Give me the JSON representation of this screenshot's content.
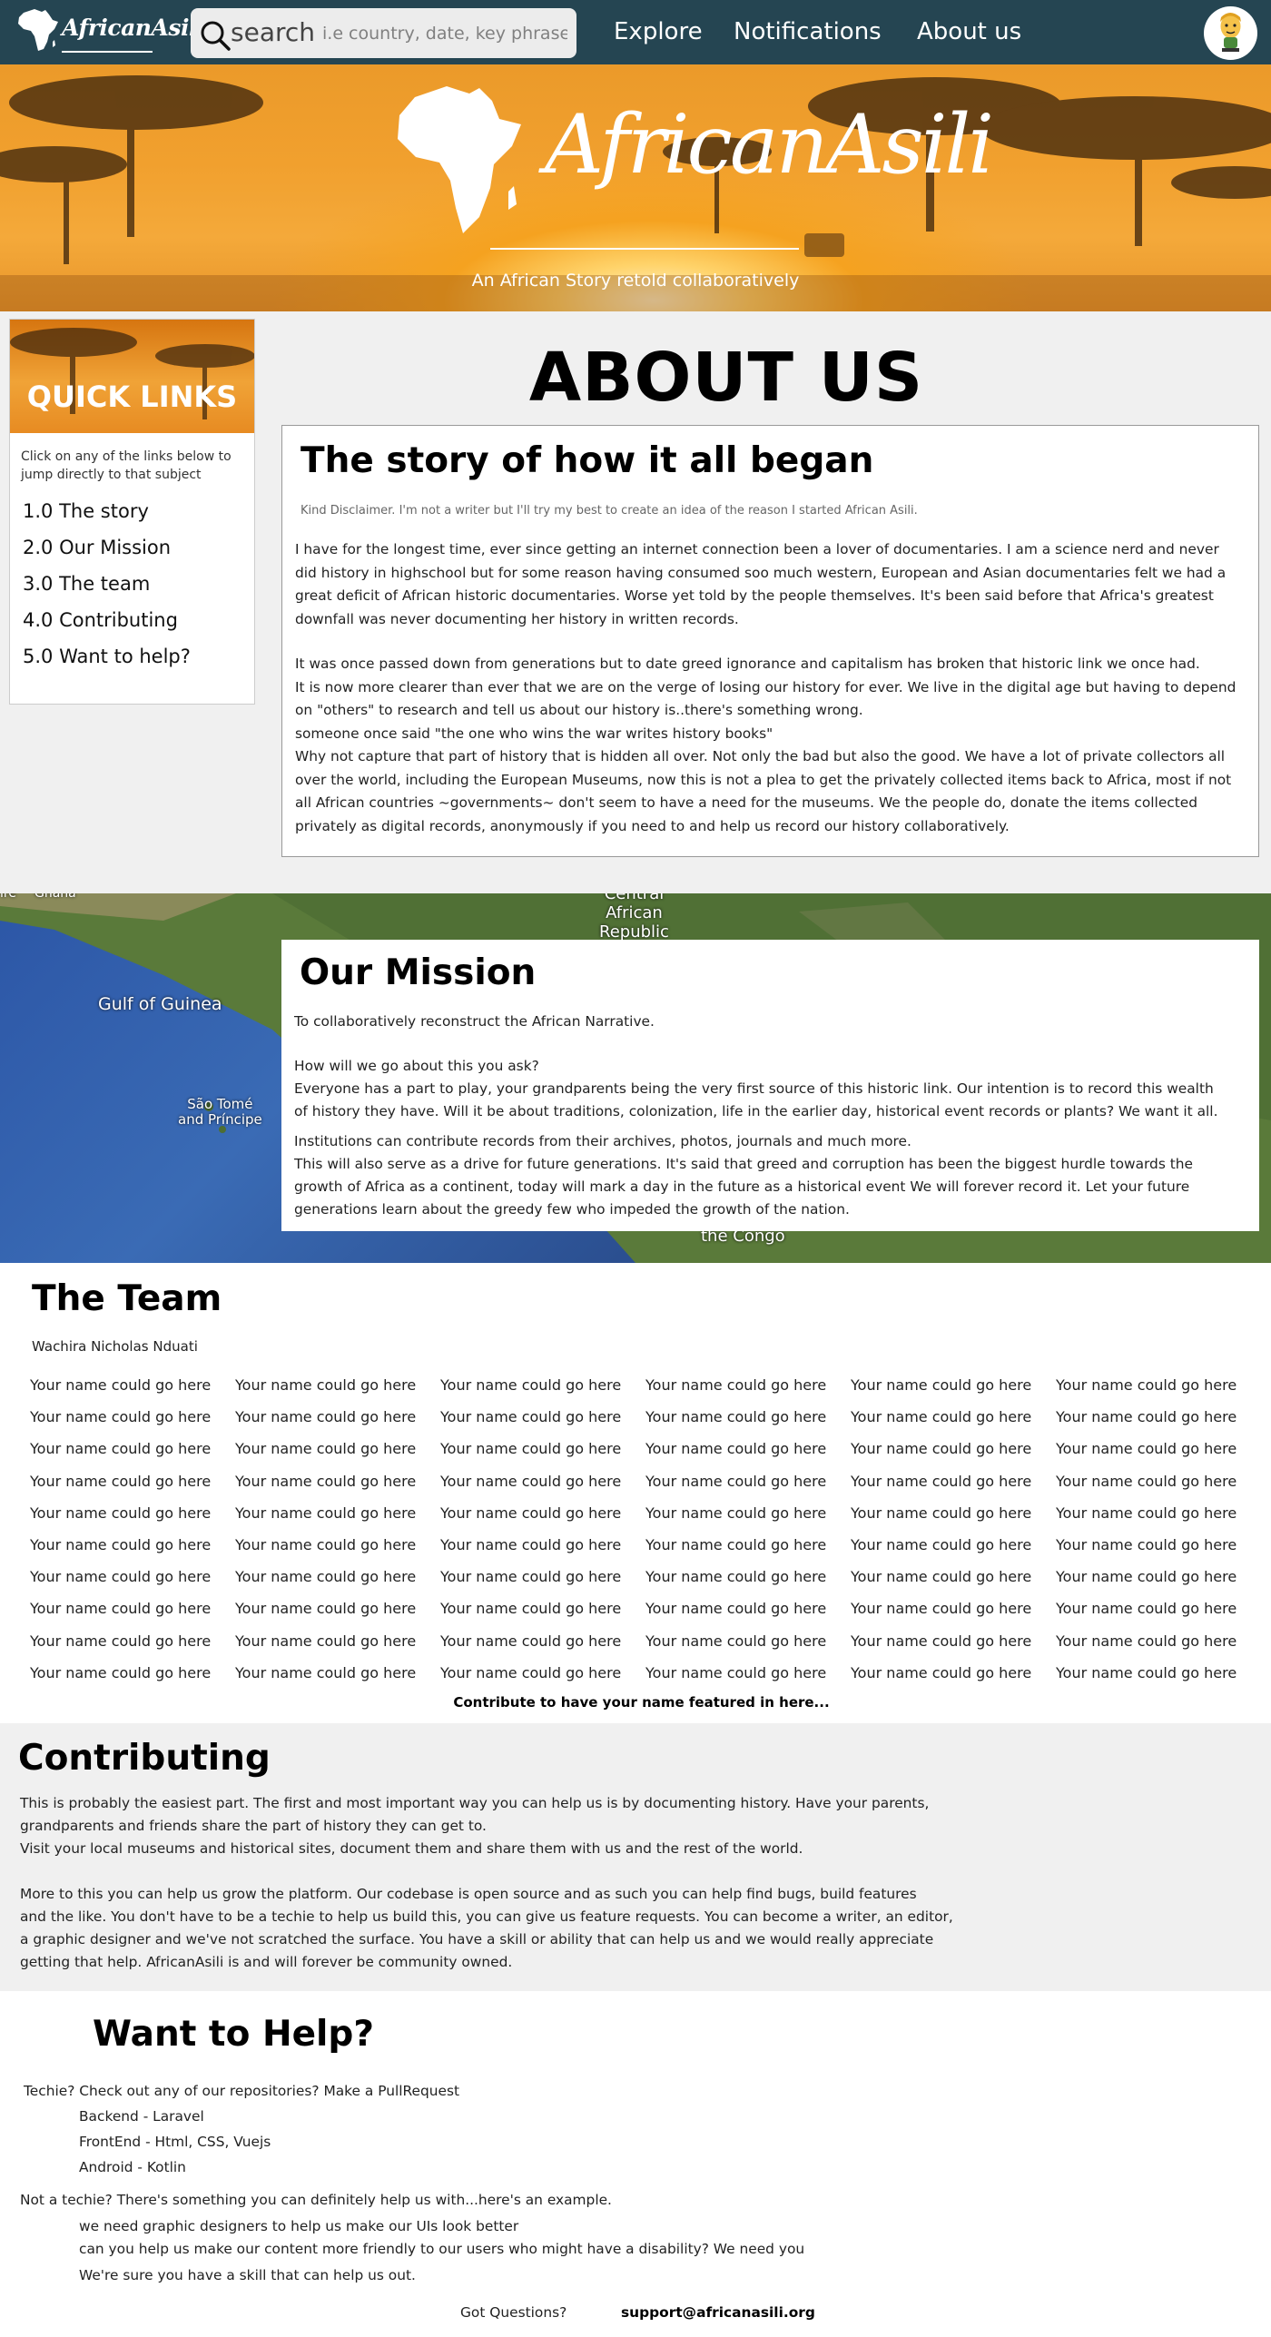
{
  "navbar": {
    "brand": "AfricanAsili",
    "search_label": "search",
    "search_placeholder": "i.e country, date, key phrase",
    "links": [
      "Explore",
      "Notifications",
      "About us"
    ]
  },
  "hero": {
    "title": "AfricanAsili",
    "subtitle": "An African Story retold collaboratively"
  },
  "quick_links": {
    "title": "QUICK LINKS",
    "intro": "Click on any of the links below to jump directly to that subject",
    "items": [
      "1.0 The story",
      "2.0 Our Mission",
      "3.0 The team",
      "4.0 Contributing",
      "5.0 Want to help?"
    ]
  },
  "about": {
    "title": "ABOUT US",
    "story_title": "The story of how it all began",
    "disclaimer": "Kind Disclaimer. I'm not a writer but I'll try my best to create an idea of the reason I started African Asili.",
    "para1": "I have for the longest time, ever since getting an internet connection been a lover of documentaries. I am a science nerd and never\ndid history in highschool but for some reason having consumed soo much western, European and Asian documentaries felt we had a\ngreat deficit of African historic documentaries. Worse yet told by the people themselves. It's been said before that Africa's greatest\ndownfall was never documenting her history in written records.",
    "para2": "It was once passed down from generations but to date greed ignorance and capitalism has broken that historic link we once had.\nIt is now more clearer than ever that we are on the verge of losing our history for ever. We live in the digital age but having to depend\non \"others\" to research and tell us about our history is..there's something wrong.\nsomeone once said \"the one who wins the war writes history books\"\nWhy not capture that part of history that is hidden all over. Not only the bad but also the good. We have a lot of private collectors all\nover the world, including the European Museums, now this is not a plea to get the privately collected items back to Africa, most if not\nall African countries ~governments~ don't seem to have a need for the museums. We the people do, donate the items collected\nprivately as digital records, anonymously if you need to and help us record our history collaboratively."
  },
  "map_labels": {
    "gulf": "Gulf of Guinea",
    "sao_tome": "São Tomé\nand Príncipe",
    "car": "Central\nAfrican\nRepublic",
    "congo": "the Congo",
    "left": "ire",
    "ghana": "Ghana"
  },
  "mission": {
    "title": "Our Mission",
    "para1": "To collaboratively reconstruct the African Narrative.",
    "para2": "How will we go about this you ask?\nEveryone has a part to play, your grandparents being the very first source of this historic link. Our intention is to record this wealth\nof history they have. Will it be about traditions, colonization, life in the earlier day, historical event records or plants? We want it all.",
    "para3": "Institutions can contribute records from their archives, photos, journals and much more.\nThis will also serve as a drive for future generations. It's said that greed and corruption has been the biggest hurdle towards the\ngrowth of Africa as a continent, today will mark a day in the future as a historical event We will forever record it. Let your future\ngenerations learn about the greedy few who impeded the growth of the nation."
  },
  "team": {
    "title": "The Team",
    "lead": "Wachira Nicholas Nduati",
    "placeholder": "Your name could go here",
    "rows": 10,
    "columns": 6,
    "cta": "Contribute to have your name featured in here..."
  },
  "contributing": {
    "title": "Contributing",
    "para1": "This is probably the easiest part. The first and most important way you can help us is by documenting history. Have your parents,\ngrandparents and friends share the part of history they can get to.\nVisit your local museums and historical sites, document them and share them with us and the rest of the world.",
    "para2": "More to this you can help us grow the platform. Our codebase is open source and as such you can help find bugs, build features\nand the like. You don't have to be a techie to help us build this, you can give us feature requests. You can become a writer, an editor,\na graphic designer and we've not scratched the surface. You have a skill or ability that can help us and we would really appreciate\ngetting that help. AfricanAsili is and will forever be community owned."
  },
  "help": {
    "title": "Want to Help?",
    "techie": "Techie? Check out any of our repositories? Make a PullRequest",
    "repos": [
      "Backend - Laravel",
      "FrontEnd - Html, CSS, Vuejs",
      "Android - Kotlin"
    ],
    "non_techie": "Not a techie? There's something you can definitely help us with...here's an example.",
    "examples": [
      "we need graphic designers to help us make our UIs look better",
      "can you help us make our content more friendly to our users who might have a disability? We need you",
      "We're sure you have a skill that can help us out."
    ],
    "questions": "Got Questions?",
    "email": "support@africanasili.org"
  },
  "colors": {
    "navbar": "#254552",
    "hero_orange": "#f0a030",
    "section_gray": "#f0f0f0"
  }
}
